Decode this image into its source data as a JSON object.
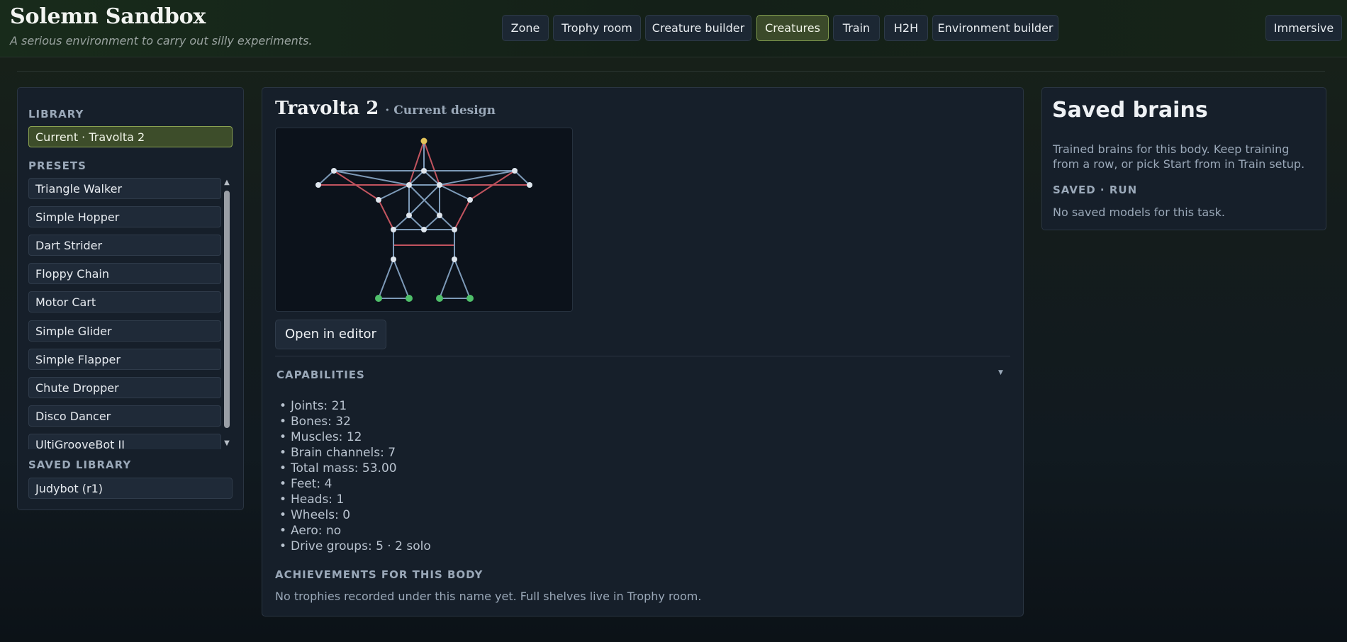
{
  "header": {
    "title": "Solemn Sandbox",
    "subtitle": "A serious environment to carry out silly experiments."
  },
  "nav": {
    "items": [
      {
        "label": "Zone"
      },
      {
        "label": "Trophy room"
      },
      {
        "label": "Creature builder"
      },
      {
        "label": "Creatures",
        "active": true
      },
      {
        "label": "Train"
      },
      {
        "label": "H2H"
      },
      {
        "label": "Environment builder"
      }
    ],
    "immersive_label": "Immersive"
  },
  "library": {
    "heading": "LIBRARY",
    "current_item": "Current · Travolta 2",
    "presets_heading": "PRESETS",
    "presets": [
      "Triangle Walker",
      "Simple Hopper",
      "Dart Strider",
      "Floppy Chain",
      "Motor Cart",
      "Simple Glider",
      "Simple Flapper",
      "Chute Dropper",
      "Disco Dancer",
      "UltiGrooveBot II"
    ],
    "saved_heading": "SAVED LIBRARY",
    "saved_items": [
      "Judybot (r1)"
    ]
  },
  "main": {
    "creature_name": "Travolta 2",
    "creature_subtitle": "· Current design",
    "open_editor_label": "Open in editor",
    "capabilities_heading": "CAPABILITIES",
    "capabilities": [
      "Joints: 21",
      "Bones: 32",
      "Muscles: 12",
      "Brain channels: 7",
      "Total mass: 53.00",
      "Feet: 4",
      "Heads: 1",
      "Wheels: 0",
      "Aero: no",
      "Drive groups: 5 · 2 solo"
    ],
    "achievements_heading": "ACHIEVEMENTS FOR THIS BODY",
    "achievements_text": "No trophies recorded under this name yet. Full shelves live in Trophy room."
  },
  "saved_brains": {
    "title": "Saved brains",
    "description": "Trained brains for this body. Keep training from a row, or pick Start from in Train setup.",
    "section_heading": "SAVED · RUN",
    "empty_text": "No saved models for this task."
  },
  "icons": {
    "collapse": "chevron-down-icon",
    "scroll_up": "scroll-up-arrow-icon",
    "scroll_down": "scroll-down-arrow-icon"
  },
  "colors": {
    "accent_active": "#3b4a2a",
    "accent_border": "#7f9a4d",
    "bone": "#7d9ab8",
    "muscle": "#c2545f",
    "head": "#e3c35a",
    "foot": "#4fbf6a",
    "joint": "#dfe6ee"
  }
}
